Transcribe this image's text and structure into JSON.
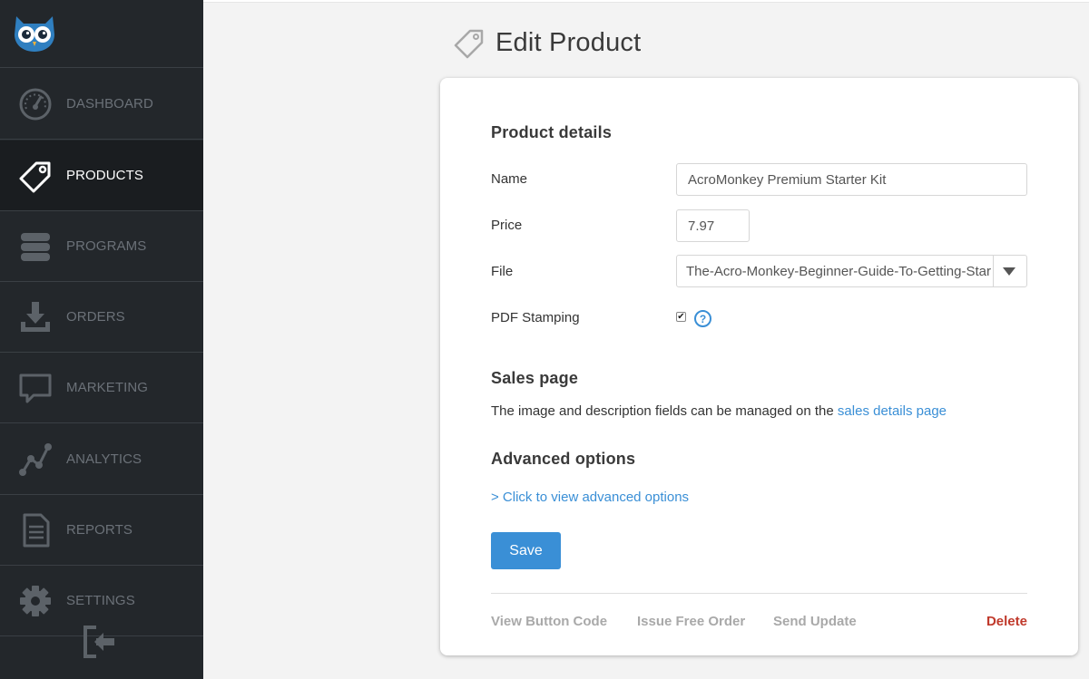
{
  "sidebar": {
    "items": [
      {
        "label": "DASHBOARD",
        "icon": "dashboard-icon"
      },
      {
        "label": "PRODUCTS",
        "icon": "tag-icon",
        "active": true
      },
      {
        "label": "PROGRAMS",
        "icon": "stack-icon"
      },
      {
        "label": "ORDERS",
        "icon": "download-tray-icon"
      },
      {
        "label": "MARKETING",
        "icon": "speech-bubble-icon"
      },
      {
        "label": "ANALYTICS",
        "icon": "line-graph-icon"
      },
      {
        "label": "REPORTS",
        "icon": "document-icon"
      },
      {
        "label": "SETTINGS",
        "icon": "gear-icon"
      }
    ],
    "logout_icon": "logout-icon"
  },
  "header": {
    "title": "Edit Product",
    "icon": "tag-icon"
  },
  "product_details": {
    "heading": "Product details",
    "name_label": "Name",
    "name_value": "AcroMonkey Premium Starter Kit",
    "price_label": "Price",
    "price_value": "7.97",
    "file_label": "File",
    "file_value": "The-Acro-Monkey-Beginner-Guide-To-Getting-Start",
    "pdf_stamping_label": "PDF Stamping",
    "pdf_stamping_checked": true,
    "help_symbol": "?"
  },
  "sales_page": {
    "heading": "Sales page",
    "text": "The image and description fields can be managed on the ",
    "link": "sales details page"
  },
  "advanced": {
    "heading": "Advanced options",
    "link": "> Click to view advanced options"
  },
  "actions": {
    "save": "Save",
    "view_button_code": "View Button Code",
    "issue_free_order": "Issue Free Order",
    "send_update": "Send Update",
    "delete": "Delete"
  },
  "colors": {
    "sidebar_bg": "#23272b",
    "accent": "#3a8fd6",
    "danger": "#c0392b"
  }
}
